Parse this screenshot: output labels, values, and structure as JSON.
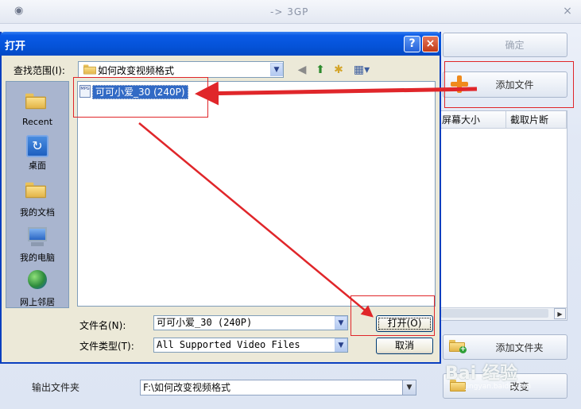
{
  "app": {
    "title": "-> 3GP",
    "close_glyph": "×",
    "buttons": {
      "confirm": "确定",
      "add_file": "添加文件",
      "add_folder": "添加文件夹",
      "change": "改变"
    },
    "table_headers": [
      "屏幕大小",
      "截取片断"
    ],
    "output_folder_label": "输出文件夹",
    "output_folder_value": "F:\\如何改变视频格式"
  },
  "dialog": {
    "title": "打开",
    "help_glyph": "?",
    "close_glyph": "×",
    "look_in_label": "查找范围(I):",
    "look_in_value": "如何改变视频格式",
    "places": [
      {
        "label": "Recent",
        "icon": "recent-folder-icon"
      },
      {
        "label": "桌面",
        "icon": "desktop-icon"
      },
      {
        "label": "我的文档",
        "icon": "my-documents-icon"
      },
      {
        "label": "我的电脑",
        "icon": "my-computer-icon"
      },
      {
        "label": "网上邻居",
        "icon": "network-places-icon"
      }
    ],
    "files": [
      {
        "name": "可可小爱_30 (240P)",
        "type_badge": "MPG",
        "selected": true
      }
    ],
    "filename_label": "文件名(N):",
    "filename_value": "可可小爱_30 (240P)",
    "filetype_label": "文件类型(T):",
    "filetype_value": "All Supported Video Files",
    "open_button": "打开(O)",
    "cancel_button": "取消"
  },
  "watermark": {
    "text": "Bai 经验",
    "sub": "jingyan.baidu.com"
  },
  "colors": {
    "dialog_title_blue": "#0553d9",
    "selection_blue": "#316ac5",
    "annotation_red": "#e0262a",
    "plus_orange": "#f08a1c"
  }
}
